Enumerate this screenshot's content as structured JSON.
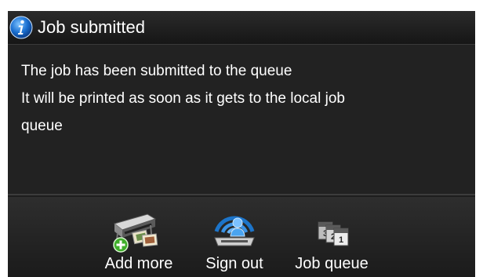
{
  "header": {
    "icon": "info-icon",
    "title": "Job submitted"
  },
  "message": {
    "line1": "The job has been submitted to the queue",
    "line2": "It will be printed as soon as it gets to the local job",
    "line3": "queue"
  },
  "actions": [
    {
      "label": "Add more",
      "icon": "add-more-printer-icon"
    },
    {
      "label": "Sign out",
      "icon": "sign-out-icon"
    },
    {
      "label": "Job queue",
      "icon": "job-queue-icon"
    }
  ],
  "colors": {
    "background": "#1e1e1e",
    "text": "#ffffff",
    "info_blue": "#1a6fd0",
    "add_green": "#3fae2a"
  }
}
